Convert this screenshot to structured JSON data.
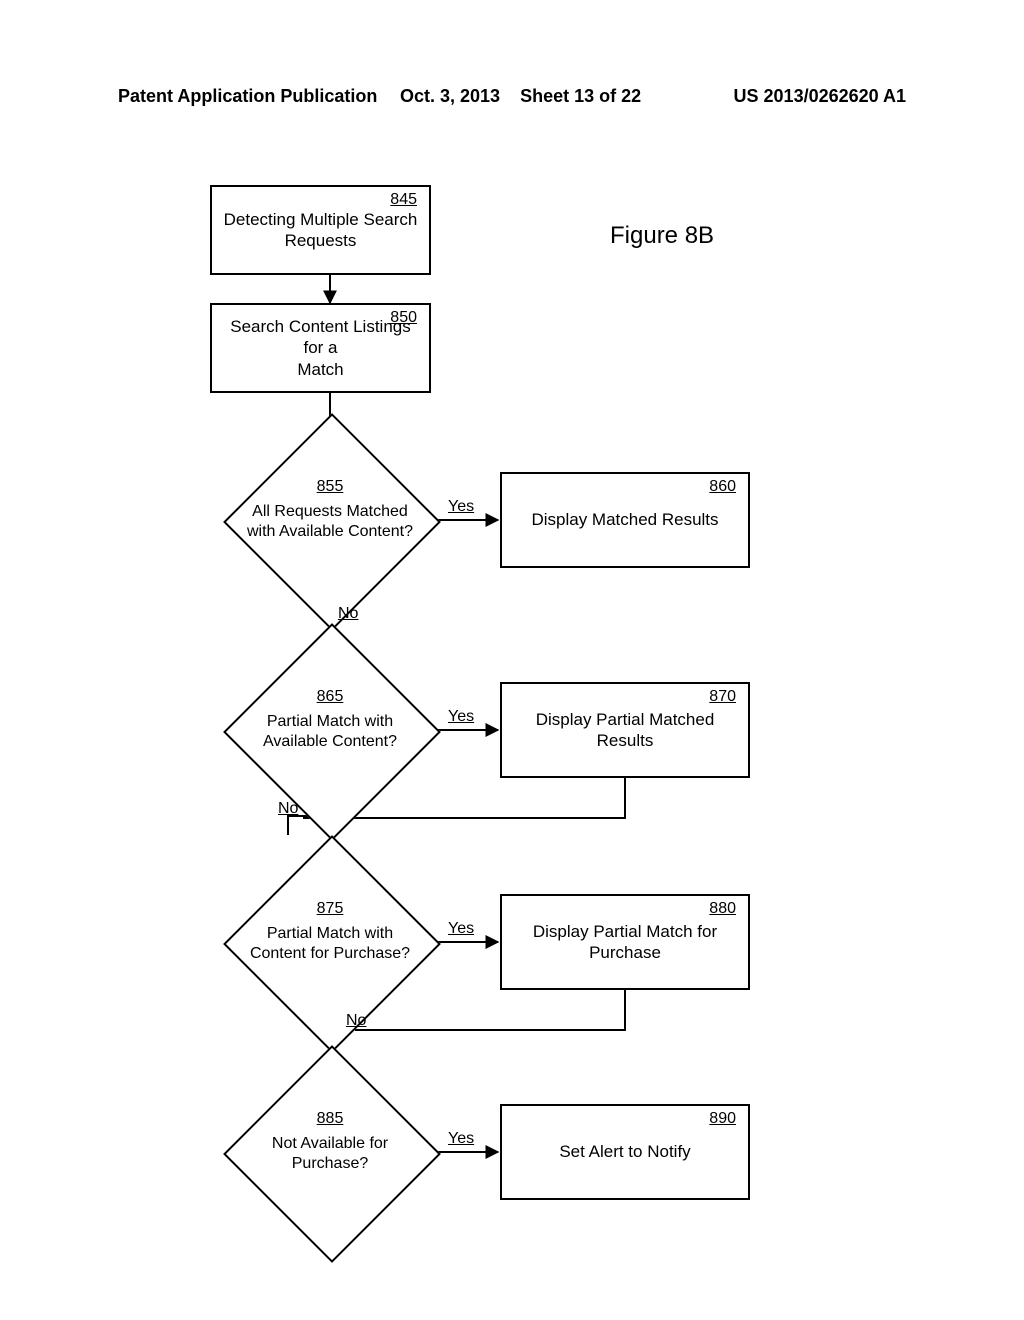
{
  "header": {
    "left": "Patent Application Publication",
    "date": "Oct. 3, 2013",
    "sheet": "Sheet 13 of 22",
    "pubno": "US 2013/0262620 A1"
  },
  "figure_label": "Figure 8B",
  "nodes": {
    "n845": {
      "ref": "845",
      "text": "Detecting Multiple Search\nRequests"
    },
    "n850": {
      "ref": "850",
      "text": "Search Content Listings for a\nMatch"
    },
    "n855": {
      "ref": "855",
      "text": "All Requests Matched\nwith Available Content?"
    },
    "n860": {
      "ref": "860",
      "text": "Display Matched Results"
    },
    "n865": {
      "ref": "865",
      "text": "Partial Match with\nAvailable Content?"
    },
    "n870": {
      "ref": "870",
      "text": "Display Partial Matched Results"
    },
    "n875": {
      "ref": "875",
      "text": "Partial Match with\nContent for Purchase?"
    },
    "n880": {
      "ref": "880",
      "text": "Display Partial Match for\nPurchase"
    },
    "n885": {
      "ref": "885",
      "text": "Not Available for\nPurchase?"
    },
    "n890": {
      "ref": "890",
      "text": "Set Alert to Notify"
    }
  },
  "edge_labels": {
    "yes855": "Yes",
    "no855": "No",
    "yes865": "Yes",
    "no865": "No",
    "yes875": "Yes",
    "no875": "No",
    "yes885": "Yes"
  }
}
